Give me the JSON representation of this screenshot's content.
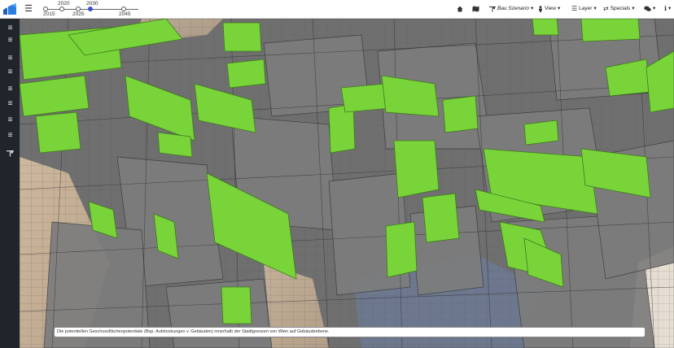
{
  "header": {
    "menu_icon": "hamburger-icon",
    "timeline": {
      "years_top": [
        "2020",
        "2030"
      ],
      "years_bottom": [
        "2015",
        "2025",
        "2045"
      ],
      "selected_year": "2030"
    },
    "toolbar": {
      "home_icon": "home-icon",
      "map_icon": "map-icon",
      "scenario_label": "Bau Szenario",
      "view_label": "View",
      "layer_label": "Layer",
      "specials_label": "Specials",
      "chat_icon": "comments-icon",
      "info_icon": "info-icon"
    }
  },
  "sidebar": {
    "items": [
      {
        "icon": "list-icon"
      },
      {
        "icon": "list-icon"
      },
      {
        "icon": "list-icon"
      },
      {
        "icon": "list-icon"
      },
      {
        "icon": "list-icon"
      },
      {
        "icon": "list-icon"
      },
      {
        "icon": "list-icon"
      },
      {
        "icon": "list-icon"
      },
      {
        "icon": "crane-icon"
      }
    ]
  },
  "map": {
    "caption": "Die potentiellen Geschossflächenpotentiale (Bsp. Aufstockungen v. Gebäuden) innerhalb der Stadtgrenzen von Wien auf Gebäudeebene.",
    "colors": {
      "potential": "#7ed63a",
      "building": "#7a7a7a",
      "ground": "#c8b49a"
    }
  }
}
